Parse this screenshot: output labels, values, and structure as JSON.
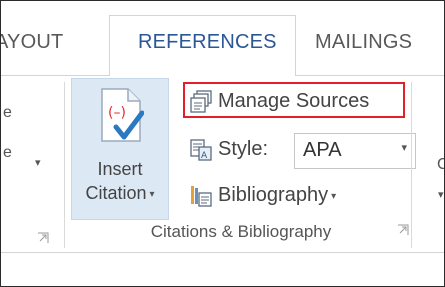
{
  "tabs": {
    "layout_label": "AYOUT",
    "references_label": "REFERENCES",
    "mailings_label": "MAILINGS"
  },
  "left_fragment": {
    "glyph_top": "e",
    "glyph_mid": "e",
    "arrow": "▾"
  },
  "insert_citation": {
    "line1": "Insert",
    "line2": "Citation",
    "caret": "▾"
  },
  "commands": {
    "manage_sources_label": "Manage Sources",
    "style_label": "Style:",
    "style_value": "APA",
    "style_caret": "▾",
    "bibliography_label": "Bibliography",
    "bibliography_caret": "▾"
  },
  "group": {
    "label": "Citations & Bibliography"
  },
  "right_fragment": {
    "glyph": "C",
    "arrow": "▾"
  },
  "icons": {
    "insert_citation": "insert-citation-icon",
    "manage_sources": "manage-sources-icon",
    "style": "style-icon",
    "bibliography": "bibliography-icon",
    "dialog_launcher": "dialog-launcher-icon"
  },
  "colors": {
    "accent_text": "#2b5797",
    "highlight_border": "#e3202a",
    "button_hover_bg": "#dde8f5",
    "citation_red": "#e0302f",
    "check_blue": "#2b79c2"
  }
}
